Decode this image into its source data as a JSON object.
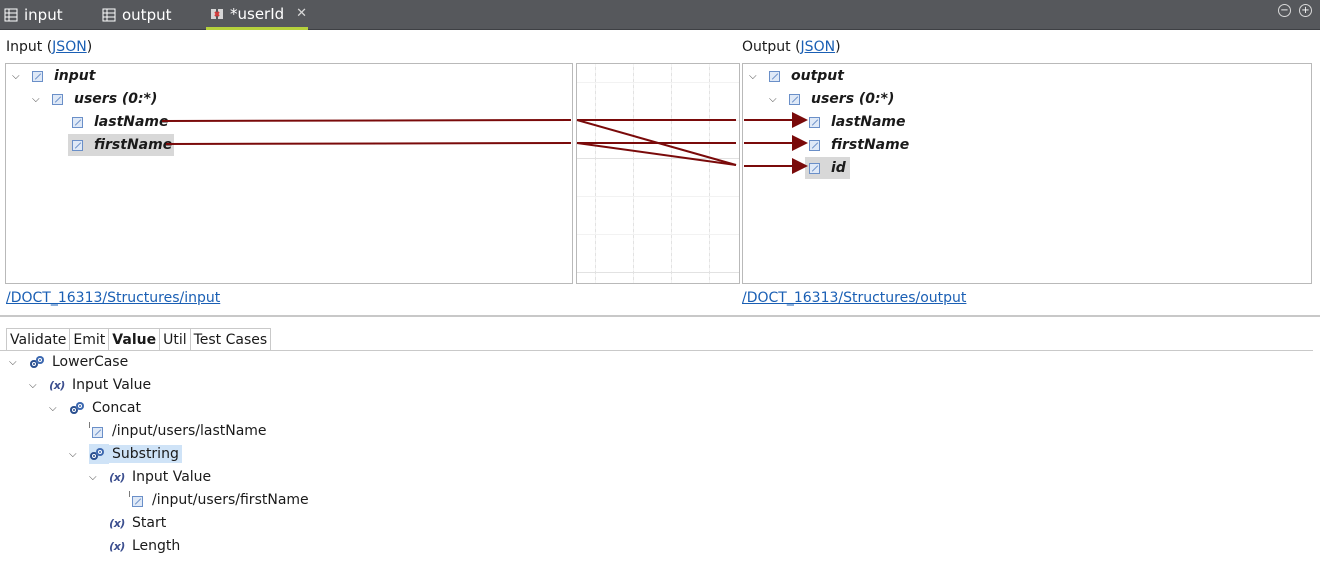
{
  "tabs": [
    {
      "label": "input",
      "icon": "table-icon",
      "active": false
    },
    {
      "label": "output",
      "icon": "table-icon",
      "active": false
    },
    {
      "label": "*userId",
      "icon": "mapping-icon",
      "active": true
    }
  ],
  "view_controls": {
    "minimize": "−",
    "maximize": "+"
  },
  "input_panel": {
    "title_prefix": "Input (",
    "title_link": "JSON",
    "title_suffix": ")",
    "tree": [
      {
        "label": "input",
        "expanded": true
      },
      {
        "label": "users (0:*)",
        "expanded": true
      },
      {
        "label": "lastName"
      },
      {
        "label": "firstName",
        "selected": true
      }
    ],
    "path": "/DOCT_16313/Structures/input"
  },
  "output_panel": {
    "title_prefix": "Output (",
    "title_link": "JSON",
    "title_suffix": ")",
    "tree": [
      {
        "label": "output",
        "expanded": true
      },
      {
        "label": "users (0:*)",
        "expanded": true
      },
      {
        "label": "lastName"
      },
      {
        "label": "firstName"
      },
      {
        "label": "id",
        "selected": true
      }
    ],
    "path": "/DOCT_16313/Structures/output"
  },
  "mapping_colors": {
    "line": "#7a0a0a"
  },
  "bottom_tabs": [
    {
      "label": "Validate"
    },
    {
      "label": "Emit"
    },
    {
      "label": "Value",
      "active": true
    },
    {
      "label": "Util"
    },
    {
      "label": "Test Cases"
    }
  ],
  "function_tree": [
    {
      "label": "LowerCase",
      "icon": "gear-icon"
    },
    {
      "label": "Input Value",
      "icon": "variable-icon"
    },
    {
      "label": "Concat",
      "icon": "gear-icon"
    },
    {
      "label": "/input/users/lastName",
      "icon": "field-icon"
    },
    {
      "label": "Substring",
      "icon": "gear-icon",
      "selected": true
    },
    {
      "label": "Input Value",
      "icon": "variable-icon"
    },
    {
      "label": "/input/users/firstName",
      "icon": "field-icon"
    },
    {
      "label": "Start",
      "icon": "variable-icon"
    },
    {
      "label": "Length",
      "icon": "variable-icon"
    }
  ],
  "variable_glyph": "(x)"
}
